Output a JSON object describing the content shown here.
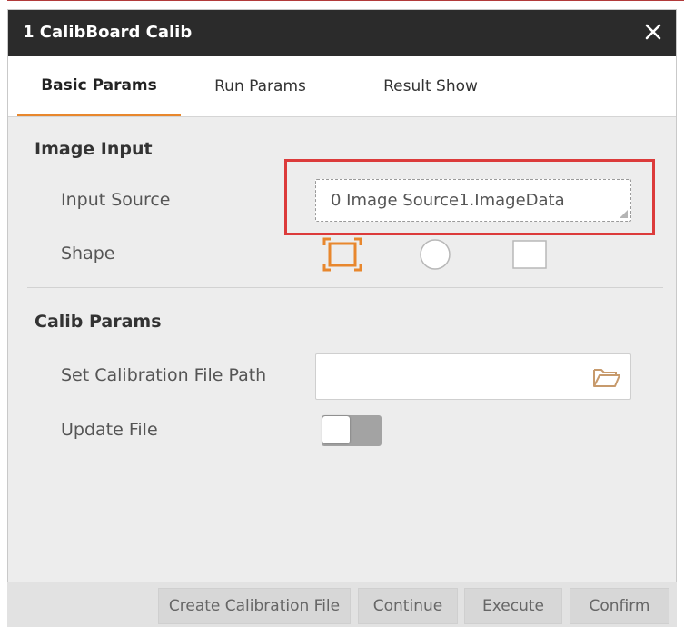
{
  "window": {
    "title": "1 CalibBoard Calib",
    "close_icon": "close-icon"
  },
  "tabs": [
    {
      "label": "Basic Params",
      "active": true
    },
    {
      "label": "Run Params",
      "active": false
    },
    {
      "label": "Result Show",
      "active": false
    }
  ],
  "image_input": {
    "section_title": "Image Input",
    "input_source_label": "Input Source",
    "input_source_value": "0 Image Source1.ImageData",
    "shape_label": "Shape",
    "shape_options": [
      "full-image-icon",
      "circle-icon",
      "rectangle-icon"
    ],
    "selected_shape": "full-image-icon"
  },
  "calib_params": {
    "section_title": "Calib Params",
    "file_path_label": "Set Calibration File Path",
    "file_path_value": "",
    "folder_icon": "folder-open-icon",
    "update_file_label": "Update File",
    "update_file_on": false
  },
  "footer": {
    "create_label": "Create Calibration File",
    "continue_label": "Continue",
    "execute_label": "Execute",
    "confirm_label": "Confirm"
  },
  "colors": {
    "accent": "#e8872d",
    "highlight": "#dc3b3b",
    "titlebar": "#2b2b2b"
  }
}
